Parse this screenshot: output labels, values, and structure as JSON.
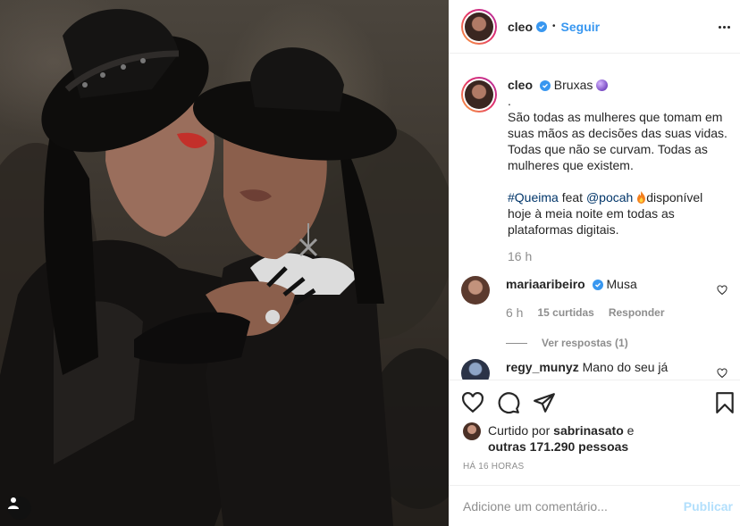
{
  "colors": {
    "link": "#3897f0",
    "muted": "#8e8e8e",
    "text": "#262626",
    "border": "#efefef"
  },
  "header": {
    "username": "cleo",
    "separator": "•",
    "follow_label": "Seguir"
  },
  "caption": {
    "username": "cleo",
    "title": "Bruxas",
    "dot": ".",
    "paragraph1": "São todas as mulheres que tomam em suas mãos as decisões das suas vidas. Todas que não se curvam. Todas as mulheres que existem.",
    "hashtag": "#Queima",
    "feat": "feat",
    "mention": "@pocah",
    "after_mention": "disponível hoje à meia noite em todas as plataformas digitais.",
    "time": "16 h"
  },
  "comments": [
    {
      "username": "mariaaribeiro",
      "text": "Musa",
      "time": "6 h",
      "likes": "15 curtidas",
      "reply_label": "Responder",
      "view_replies": "Ver respostas (1)"
    },
    {
      "username": "regy_munyz",
      "text": "Mano do seu já"
    }
  ],
  "likes": {
    "prefix": "Curtido por",
    "user": "sabrinasato",
    "and": "e",
    "others": "outras 171.290 pessoas"
  },
  "timestamp": "HÁ 16 HORAS",
  "add_comment": {
    "placeholder": "Adicione um comentário...",
    "publish_label": "Publicar"
  },
  "icons": [
    "heart-icon",
    "comment-icon",
    "share-icon",
    "bookmark-icon",
    "more-icon",
    "verified-icon",
    "tag-user-icon"
  ]
}
